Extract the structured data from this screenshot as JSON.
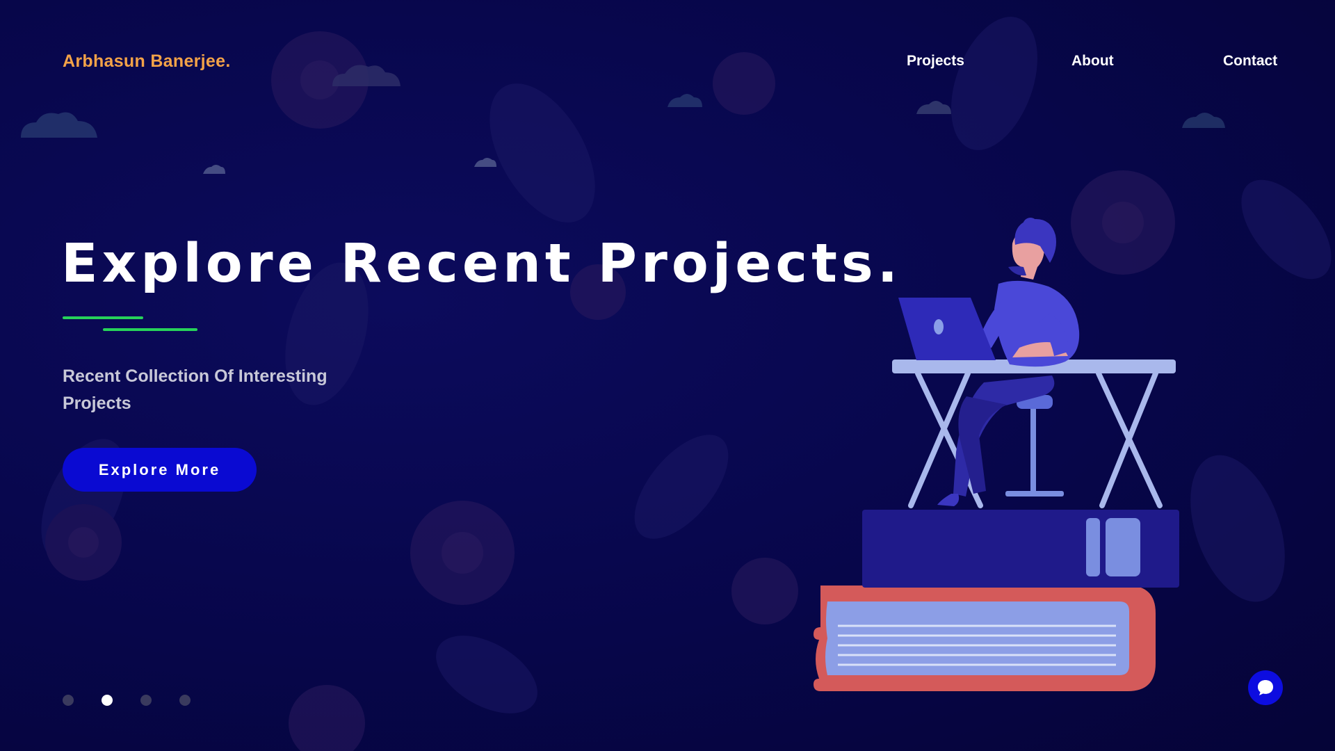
{
  "header": {
    "brand": "Arbhasun Banerjee.",
    "nav": [
      {
        "label": "Projects"
      },
      {
        "label": "About"
      },
      {
        "label": "Contact"
      }
    ]
  },
  "hero": {
    "title": "Explore Recent Projects.",
    "subtitle": "Recent Collection Of Interesting Projects",
    "cta_label": "Explore More"
  },
  "slider": {
    "count": 4,
    "active_index": 1
  },
  "icons": {
    "chat": "chat-bubble-icon",
    "illustration": "person-at-desk-on-books-illustration"
  },
  "colors": {
    "background": "#07064a",
    "brand": "#f2a248",
    "accent_line": "#27d35a",
    "cta": "#0a0ad2",
    "chat": "#0d0de0"
  }
}
